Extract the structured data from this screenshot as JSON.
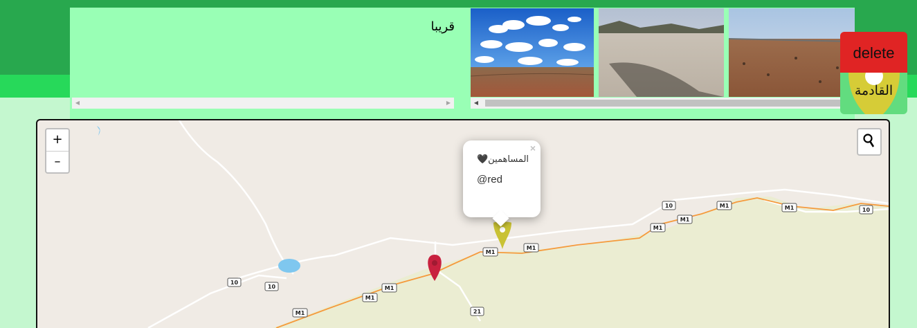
{
  "panel": {
    "soon_text": "قريبا"
  },
  "buttons": {
    "delete_label": "delete",
    "upcoming_label": "القادمة"
  },
  "map": {
    "zoom_in": "+",
    "zoom_out": "–",
    "popup": {
      "close": "×",
      "title": "المساهمين🖤",
      "handle": "@red"
    },
    "road_labels": [
      "10",
      "10",
      "M1",
      "M1",
      "M1",
      "M1",
      "10",
      "M1",
      "M1",
      "M1",
      "10",
      "10",
      "M1",
      "M1",
      "21"
    ]
  },
  "icons": {
    "search": "magnifier-icon",
    "marker_red": "map-pin-icon",
    "marker_yellow": "map-pin-icon"
  },
  "colors": {
    "header_dark": "#28a84e",
    "header_light": "#27d95a",
    "panel": "#99ffb5",
    "delete": "#e02424",
    "marker_red": "#c8213f",
    "marker_yellow": "#c9c234"
  }
}
